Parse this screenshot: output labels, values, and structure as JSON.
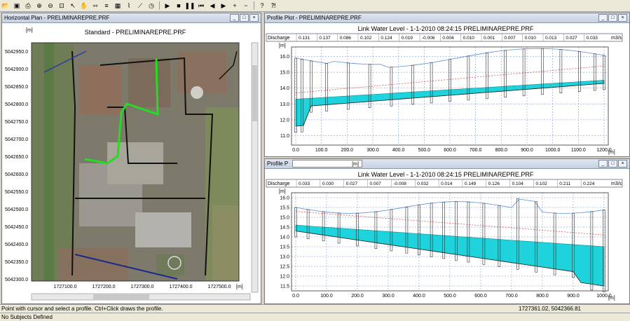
{
  "toolbar": {
    "icons": [
      "open-icon",
      "save-icon",
      "print-icon",
      "zoom-in-icon",
      "zoom-out-icon",
      "zoom-extent-icon",
      "select-icon",
      "pan-icon",
      "measure-icon",
      "layers-icon",
      "table-icon",
      "graph-icon",
      "profile-icon",
      "time-icon",
      "play-icon",
      "stop-icon",
      "pause-icon",
      "rewind-icon",
      "step-back-icon",
      "step-forward-icon",
      "add-icon",
      "chart-icon",
      "help-icon",
      "context-help-icon"
    ]
  },
  "plan": {
    "window_title": "Horizontal Plan - PRELIMINAREPRE.PRF",
    "map_title": "Standard - PRELIMINAREPRE.PRF",
    "y_unit": "[m]",
    "x_unit": "[m]",
    "y_ticks": [
      "5042950.0",
      "5042900.0",
      "5042850.0",
      "5042800.0",
      "5042750.0",
      "5042700.0",
      "5042650.0",
      "5042600.0",
      "5042550.0",
      "5042500.0",
      "5042450.0",
      "5042400.0",
      "5042350.0",
      "5042300.0"
    ],
    "x_ticks": [
      "1727100.0",
      "1727200.0",
      "1727300.0",
      "1727400.0",
      "1727500.0"
    ]
  },
  "profile1": {
    "window_title": "Profile Plot - PRELIMINAREPRE.PRF",
    "plot_title": "Link Water Level - 1-1-2010 08:24:15 PRELIMINAREPRE.PRF",
    "discharge_label": "Discharge",
    "discharge_unit": "m3/s",
    "discharge_values": [
      "0.131",
      "0.137",
      "0.086",
      "0.102",
      "0.124",
      "0.019",
      "-0.006",
      "0.004",
      "0.010",
      "0.001",
      "0.007",
      "0.010",
      "0.013",
      "0.027",
      "0.033"
    ],
    "y_unit": "[m]",
    "x_unit": "[m]",
    "y_ticks": [
      "16.0",
      "15.0",
      "14.0",
      "13.0",
      "12.0",
      "11.0"
    ],
    "x_ticks": [
      "0.0",
      "100.0",
      "200.0",
      "300.0",
      "400.0",
      "500.0",
      "600.0",
      "700.0",
      "800.0",
      "900.0",
      "1000.0",
      "1100.0",
      "1200.0"
    ]
  },
  "profile2": {
    "window_title": "Profile P",
    "window_title_unit": "[m]",
    "plot_title": "Link Water Level - 1-1-2010 08:24:15 PRELIMINAREPRE.PRF",
    "discharge_label": "Discharge",
    "discharge_unit": "m3/s",
    "discharge_values": [
      "0.033",
      "0.030",
      "0.027",
      "0.007",
      "-0.008",
      "0.032",
      "0.014",
      "0.149",
      "0.126",
      "0.104",
      "0.102",
      "0.211",
      "0.224"
    ],
    "y_unit": "[m]",
    "x_unit": "[m]",
    "y_ticks": [
      "16.0",
      "15.5",
      "15.0",
      "14.5",
      "14.0",
      "13.5",
      "13.0",
      "12.5",
      "12.0",
      "11.5"
    ],
    "x_ticks": [
      "0.0",
      "100.0",
      "200.0",
      "300.0",
      "400.0",
      "500.0",
      "600.0",
      "700.0",
      "800.0",
      "900.0",
      "1000.0"
    ]
  },
  "status": {
    "hint": "Point with cursor and select a profile. Ctrl+Click draws the profile.",
    "coordinates": "1727361.02, 5042366.81",
    "subjects": "No Subjects Defined"
  },
  "colors": {
    "water": "#1fd3dc",
    "route": "#22dd22",
    "grid": "#6a8bd6",
    "surface": "#5b8fd6",
    "energy": "#e04040",
    "title_bar": "#c6d0e0"
  }
}
